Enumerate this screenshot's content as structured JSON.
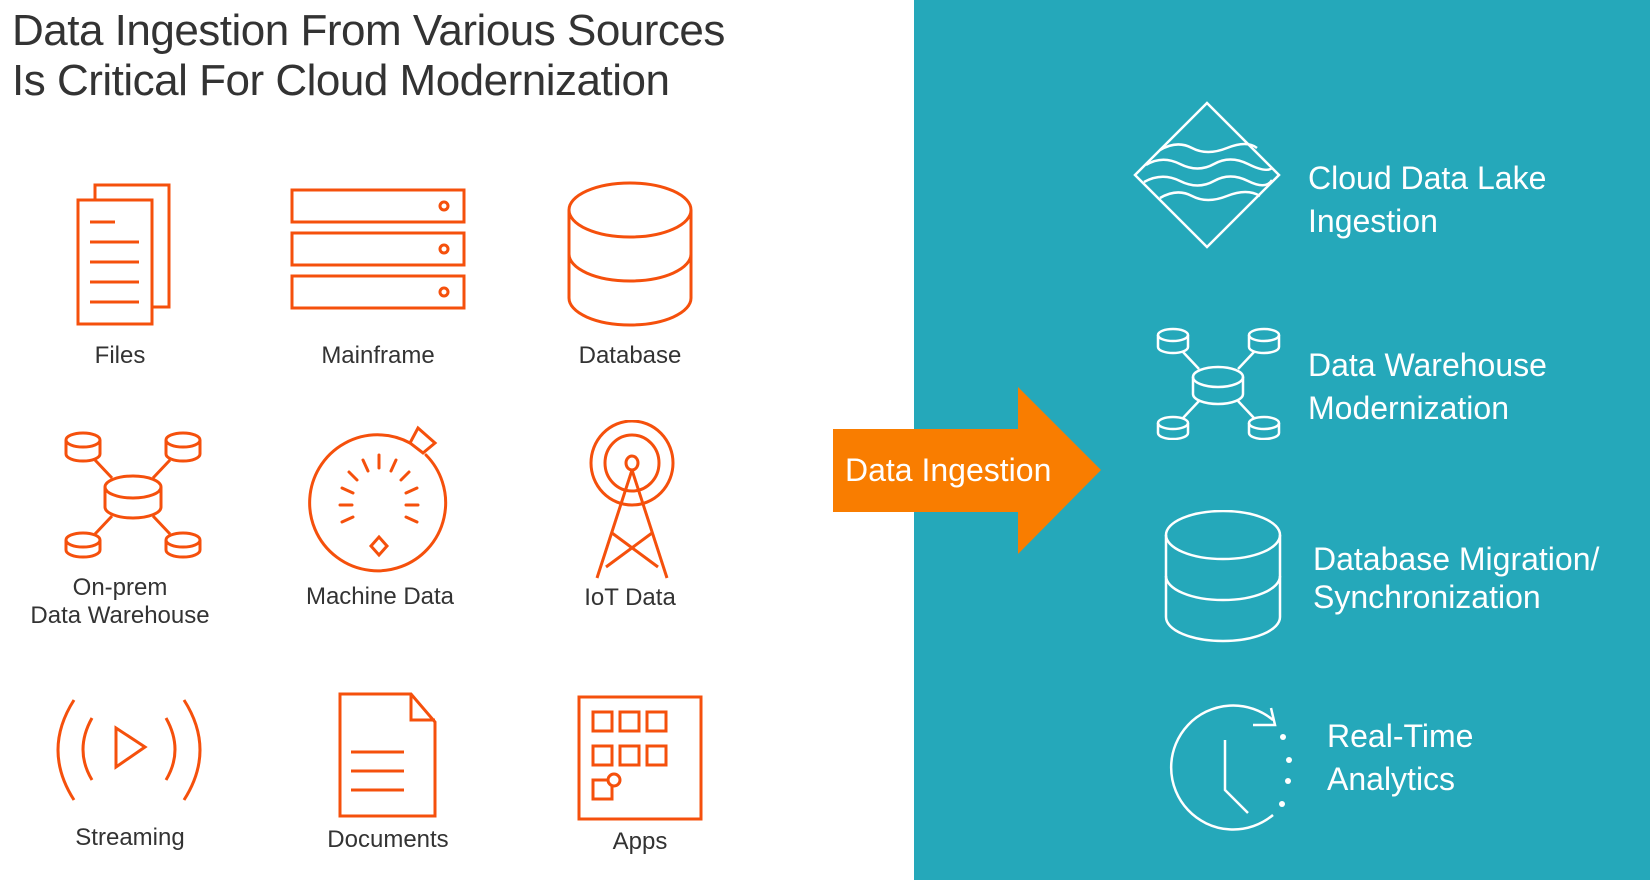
{
  "title": {
    "line1": "Data Ingestion From Various Sources",
    "line2": "Is Critical For Cloud Modernization"
  },
  "colors": {
    "source_icon": "#F5500C",
    "panel_bg": "#25A8BA",
    "arrow": "#F97D00",
    "text_dark": "#333333",
    "text_light": "#FFFFFF"
  },
  "sources": [
    {
      "label": "Files",
      "icon": "files-icon"
    },
    {
      "label": "Mainframe",
      "icon": "mainframe-icon"
    },
    {
      "label": "Database",
      "icon": "database-icon"
    },
    {
      "label_line1": "On-prem",
      "label_line2": "Data Warehouse",
      "icon": "data-warehouse-icon"
    },
    {
      "label": "Machine Data",
      "icon": "gauge-icon"
    },
    {
      "label": "IoT Data",
      "icon": "antenna-tower-icon"
    },
    {
      "label": "Streaming",
      "icon": "streaming-icon"
    },
    {
      "label": "Documents",
      "icon": "document-icon"
    },
    {
      "label": "Apps",
      "icon": "apps-grid-icon"
    }
  ],
  "arrow": {
    "label": "Data Ingestion",
    "icon": "arrow-right-icon"
  },
  "targets": [
    {
      "line1": "Cloud Data Lake",
      "line2": "Ingestion",
      "icon": "data-lake-icon"
    },
    {
      "line1": "Data Warehouse",
      "line2": "Modernization",
      "icon": "data-warehouse-icon"
    },
    {
      "line1": "Database Migration/",
      "line2": "Synchronization",
      "icon": "database-icon"
    },
    {
      "line1": "Real-Time",
      "line2": "Analytics",
      "icon": "realtime-clock-icon"
    }
  ]
}
